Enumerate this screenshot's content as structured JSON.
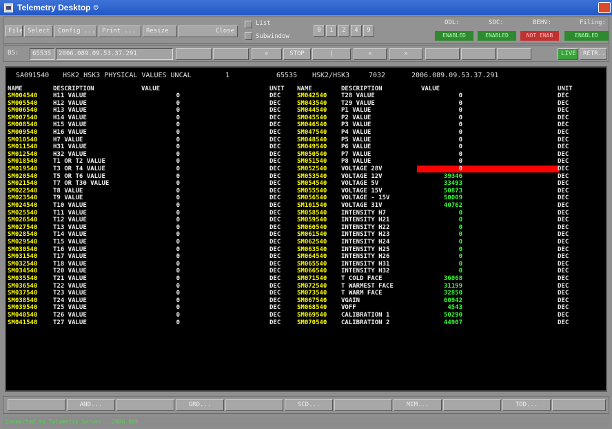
{
  "window": {
    "title": "Telemetry Desktop"
  },
  "menu": {
    "file": "File",
    "select": "Select",
    "config": "Config ...",
    "print": "Print ...",
    "resize": "Resize",
    "close": "Close",
    "list_label": "List",
    "subwindow_label": "Subwindow",
    "pages": [
      "0",
      "1",
      "2",
      "4",
      "9"
    ],
    "status_labels": [
      "ODL:",
      "SOC:",
      "BEHV:",
      "Filing:"
    ],
    "status_values": [
      "ENABLED",
      "ENABLED",
      "NOT ENAB",
      "ENABLED"
    ],
    "status_colors": [
      "#2f8a2f",
      "#2f8a2f",
      "#c23030",
      "#2f8a2f"
    ]
  },
  "toolbar": {
    "bs_label": "BS:",
    "bs_value": "65535",
    "time_value": "2006.089.09.53.37.291",
    "prev": "«",
    "stop": "STOP",
    "play": "|",
    "close_x": "✕",
    "next": "»",
    "live": "LIVE",
    "retr": "RETR..."
  },
  "header": {
    "id": "SA091540",
    "title": "HSK2_HSK3 PHYSICAL VALUES UNCAL",
    "num": "1",
    "bs": "65535",
    "group": "HSK2/HSK3",
    "count": "7032",
    "timestamp": "2006.089.09.53.37.291"
  },
  "columns": {
    "name": "NAME",
    "description": "DESCRIPTION",
    "value": "VALUE",
    "unit": "UNIT"
  },
  "left_rows": [
    {
      "name": "SM004540",
      "desc": "H11 VALUE",
      "value": "0",
      "unit": "DEC"
    },
    {
      "name": "SM005540",
      "desc": "H12 VALUE",
      "value": "0",
      "unit": "DEC"
    },
    {
      "name": "SM006540",
      "desc": "H13 VALUE",
      "value": "0",
      "unit": "DEC"
    },
    {
      "name": "SM007540",
      "desc": "H14 VALUE",
      "value": "0",
      "unit": "DEC"
    },
    {
      "name": "SM008540",
      "desc": "H15 VALUE",
      "value": "0",
      "unit": "DEC"
    },
    {
      "name": "SM009540",
      "desc": "H16 VALUE",
      "value": "0",
      "unit": "DEC"
    },
    {
      "name": "SM010540",
      "desc": "H7 VALUE",
      "value": "0",
      "unit": "DEC"
    },
    {
      "name": "SM011540",
      "desc": "H31 VALUE",
      "value": "0",
      "unit": "DEC"
    },
    {
      "name": "SM012540",
      "desc": "H32 VALUE",
      "value": "0",
      "unit": "DEC"
    },
    {
      "name": "SM018540",
      "desc": "T1 OR T2 VALUE",
      "value": "0",
      "unit": "DEC"
    },
    {
      "name": "SM019540",
      "desc": "T3 OR T4 VALUE",
      "value": "0",
      "unit": "DEC"
    },
    {
      "name": "SM020540",
      "desc": "T5 OR T6 VALUE",
      "value": "0",
      "unit": "DEC"
    },
    {
      "name": "SM021540",
      "desc": "T7 OR T30 VALUE",
      "value": "0",
      "unit": "DEC"
    },
    {
      "name": "SM022540",
      "desc": "T8 VALUE",
      "value": "0",
      "unit": "DEC"
    },
    {
      "name": "SM023540",
      "desc": "T9 VALUE",
      "value": "0",
      "unit": "DEC"
    },
    {
      "name": "SM024540",
      "desc": "T10 VALUE",
      "value": "0",
      "unit": "DEC"
    },
    {
      "name": "SM025540",
      "desc": "T11 VALUE",
      "value": "0",
      "unit": "DEC"
    },
    {
      "name": "SM026540",
      "desc": "T12 VALUE",
      "value": "0",
      "unit": "DEC"
    },
    {
      "name": "SM027540",
      "desc": "T13 VALUE",
      "value": "0",
      "unit": "DEC"
    },
    {
      "name": "SM028540",
      "desc": "T14 VALUE",
      "value": "0",
      "unit": "DEC"
    },
    {
      "name": "SM029540",
      "desc": "T15 VALUE",
      "value": "0",
      "unit": "DEC"
    },
    {
      "name": "SM030540",
      "desc": "T16 VALUE",
      "value": "0",
      "unit": "DEC"
    },
    {
      "name": "SM031540",
      "desc": "T17 VALUE",
      "value": "0",
      "unit": "DEC"
    },
    {
      "name": "SM032540",
      "desc": "T18 VALUE",
      "value": "0",
      "unit": "DEC"
    },
    {
      "name": "SM034540",
      "desc": "T20 VALUE",
      "value": "0",
      "unit": "DEC"
    },
    {
      "name": "SM035540",
      "desc": "T21 VALUE",
      "value": "0",
      "unit": "DEC"
    },
    {
      "name": "SM036540",
      "desc": "T22 VALUE",
      "value": "0",
      "unit": "DEC"
    },
    {
      "name": "SM037540",
      "desc": "T23 VALUE",
      "value": "0",
      "unit": "DEC"
    },
    {
      "name": "SM038540",
      "desc": "T24 VALUE",
      "value": "0",
      "unit": "DEC"
    },
    {
      "name": "SM039540",
      "desc": "T25 VALUE",
      "value": "0",
      "unit": "DEC"
    },
    {
      "name": "SM040540",
      "desc": "T26 VALUE",
      "value": "0",
      "unit": "DEC"
    },
    {
      "name": "SM041540",
      "desc": "T27 VALUE",
      "value": "0",
      "unit": "DEC"
    }
  ],
  "right_rows": [
    {
      "name": "SM042540",
      "desc": "T28 VALUE",
      "value": "0",
      "unit": "DEC"
    },
    {
      "name": "SM043540",
      "desc": "T29 VALUE",
      "value": "0",
      "unit": "DEC"
    },
    {
      "name": "SM044540",
      "desc": "P1 VALUE",
      "value": "0",
      "unit": "DEC"
    },
    {
      "name": "SM045540",
      "desc": "P2 VALUE",
      "value": "0",
      "unit": "DEC"
    },
    {
      "name": "SM046540",
      "desc": "P3 VALUE",
      "value": "0",
      "unit": "DEC"
    },
    {
      "name": "SM047540",
      "desc": "P4 VALUE",
      "value": "0",
      "unit": "DEC"
    },
    {
      "name": "SM048540",
      "desc": "P5 VALUE",
      "value": "0",
      "unit": "DEC"
    },
    {
      "name": "SM049540",
      "desc": "P6 VALUE",
      "value": "0",
      "unit": "DEC"
    },
    {
      "name": "SM050540",
      "desc": "P7 VALUE",
      "value": "0",
      "unit": "DEC"
    },
    {
      "name": "SM051540",
      "desc": "P8 VALUE",
      "value": "0",
      "unit": "DEC"
    },
    {
      "name": "SM052540",
      "desc": "VOLTAGE 28V",
      "value": "0",
      "unit": "DEC",
      "alarm": true
    },
    {
      "name": "SM053540",
      "desc": "VOLTAGE 12V",
      "value": "39346",
      "unit": "DEC"
    },
    {
      "name": "SM054540",
      "desc": "VOLTAGE 5V",
      "value": "33493",
      "unit": "DEC"
    },
    {
      "name": "SM055540",
      "desc": "VOLTAGE 15V",
      "value": "50873",
      "unit": "DEC"
    },
    {
      "name": "SM056540",
      "desc": "VOLTAGE - 15V",
      "value": "50009",
      "unit": "DEC"
    },
    {
      "name": "SM101540",
      "desc": "VOLTAGE 31V",
      "value": "40762",
      "unit": "DEC"
    },
    {
      "name": "SM058540",
      "desc": "INTENSITY H7",
      "value": "0",
      "unit": "DEC"
    },
    {
      "name": "SM059540",
      "desc": "INTENSITY H21",
      "value": "0",
      "unit": "DEC"
    },
    {
      "name": "SM060540",
      "desc": "INTENSITY H22",
      "value": "0",
      "unit": "DEC"
    },
    {
      "name": "SM061540",
      "desc": "INTENSITY H23",
      "value": "0",
      "unit": "DEC"
    },
    {
      "name": "SM062540",
      "desc": "INTENSITY H24",
      "value": "0",
      "unit": "DEC"
    },
    {
      "name": "SM063540",
      "desc": "INTENSITY H25",
      "value": "0",
      "unit": "DEC"
    },
    {
      "name": "SM064540",
      "desc": "INTENSITY H26",
      "value": "0",
      "unit": "DEC"
    },
    {
      "name": "SM065540",
      "desc": "INTENSITY H31",
      "value": "0",
      "unit": "DEC"
    },
    {
      "name": "SM066540",
      "desc": "INTENSITY H32",
      "value": "0",
      "unit": "DEC"
    },
    {
      "name": "SM071540",
      "desc": "T COLD FACE",
      "value": "36068",
      "unit": "DEC"
    },
    {
      "name": "SM072540",
      "desc": "T WARMEST FACE",
      "value": "31199",
      "unit": "DEC"
    },
    {
      "name": "SM073540",
      "desc": "T WARM FACE",
      "value": "32850",
      "unit": "DEC"
    },
    {
      "name": "SM067540",
      "desc": "VGAIN",
      "value": "60942",
      "unit": "DEC"
    },
    {
      "name": "SM068540",
      "desc": "VOFF",
      "value": "4543",
      "unit": "DEC"
    },
    {
      "name": "SM069540",
      "desc": "CALIBRATION 1",
      "value": "50290",
      "unit": "DEC"
    },
    {
      "name": "SM070540",
      "desc": "CALIBRATION 2",
      "value": "44907",
      "unit": "DEC"
    }
  ],
  "bottom": {
    "buttons": [
      "AND...",
      "GRD...",
      "SCD...",
      "MIM...",
      "TOD..."
    ]
  },
  "status": {
    "text": "Connected to Telemetry Server - 2006.089"
  },
  "colors": {
    "alarm": "#ff0000",
    "value_green": "#33ff33",
    "name_yellow": "#ffff00"
  }
}
